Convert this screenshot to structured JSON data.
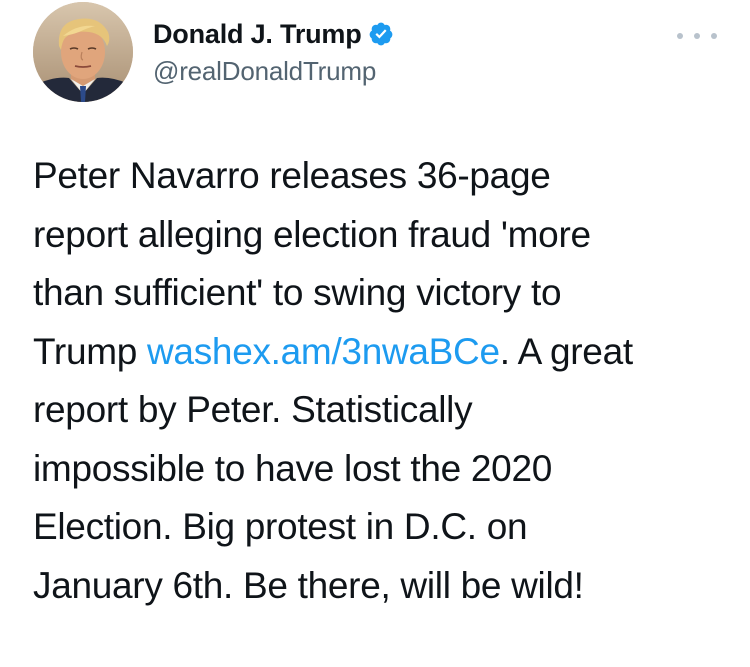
{
  "author": {
    "display_name": "Donald J. Trump",
    "handle": "@realDonaldTrump",
    "verified_icon": "verified-badge-icon",
    "avatar_icon": "avatar-image"
  },
  "menu": {
    "icon": "more-options-icon"
  },
  "tweet": {
    "line1": "Peter Navarro releases 36-page",
    "line2": "report alleging election fraud 'more",
    "line3": "than sufficient' to swing victory to",
    "line4_pre": "Trump ",
    "line4_link": "washex.am/3nwaBCe",
    "line4_post": ". A great",
    "line5": "report by Peter. Statistically",
    "line6": "impossible to have lost the 2020",
    "line7": "Election. Big protest in D.C. on",
    "line8": "January 6th. Be there, will be wild!"
  },
  "colors": {
    "text": "#0f1419",
    "secondary": "#536471",
    "link": "#1d9bf0",
    "verified": "#1d9bf0"
  }
}
